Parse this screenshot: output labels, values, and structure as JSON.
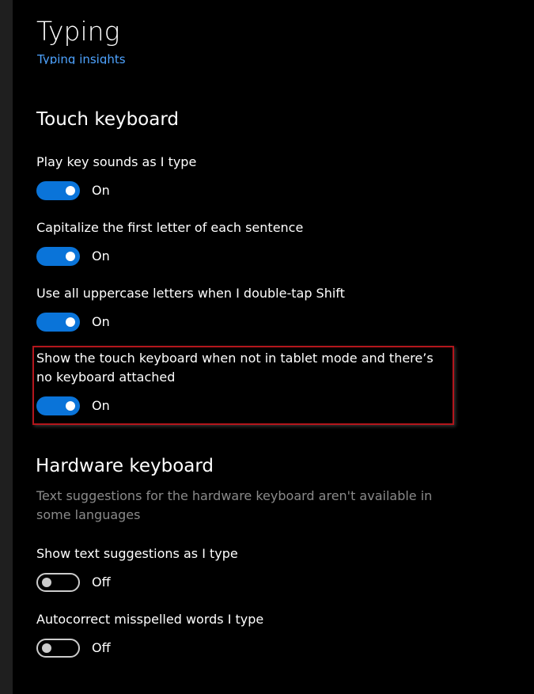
{
  "page": {
    "title": "Typing",
    "link": "Typing insights"
  },
  "touch_keyboard": {
    "title": "Touch keyboard",
    "settings": [
      {
        "label": "Play key sounds as I type",
        "state": "On"
      },
      {
        "label": "Capitalize the first letter of each sentence",
        "state": "On"
      },
      {
        "label": "Use all uppercase letters when I double-tap Shift",
        "state": "On"
      },
      {
        "label": "Show the touch keyboard when not in tablet mode and there’s no keyboard attached",
        "state": "On"
      }
    ]
  },
  "hardware_keyboard": {
    "title": "Hardware keyboard",
    "description": "Text suggestions for the hardware keyboard aren't available in some languages",
    "settings": [
      {
        "label": "Show text suggestions as I type",
        "state": "Off"
      },
      {
        "label": "Autocorrect misspelled words I type",
        "state": "Off"
      }
    ]
  },
  "colors": {
    "accent": "#0a74d9",
    "link": "#4ea3ff",
    "highlight": "#b3161c",
    "background": "#000000"
  }
}
